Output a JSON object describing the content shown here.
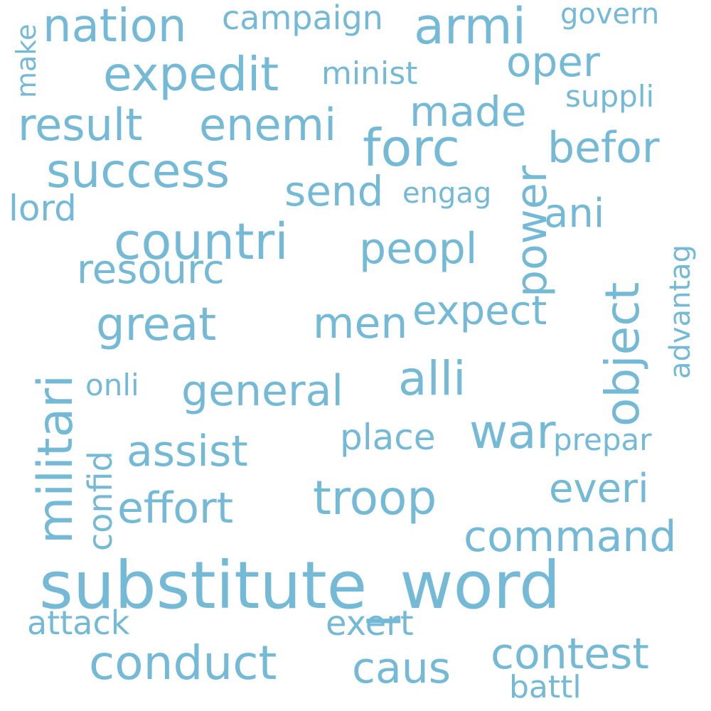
{
  "cloud": {
    "color": "#74b9d6",
    "words": [
      "substitute_word",
      "militari",
      "countri",
      "forc",
      "armi",
      "nation",
      "expedit",
      "result",
      "enemi",
      "success",
      "object",
      "power",
      "great",
      "general",
      "alli",
      "war",
      "troop",
      "effort",
      "assist",
      "command",
      "conduct",
      "contest",
      "caus",
      "befor",
      "oper",
      "made",
      "send",
      "peopl",
      "resourc",
      "men",
      "expect",
      "ani",
      "everi",
      "campaign",
      "minist",
      "suppli",
      "govern",
      "make",
      "lord",
      "engag",
      "advantag",
      "onli",
      "confid",
      "place",
      "prepar",
      "attack",
      "exert",
      "battl"
    ]
  }
}
